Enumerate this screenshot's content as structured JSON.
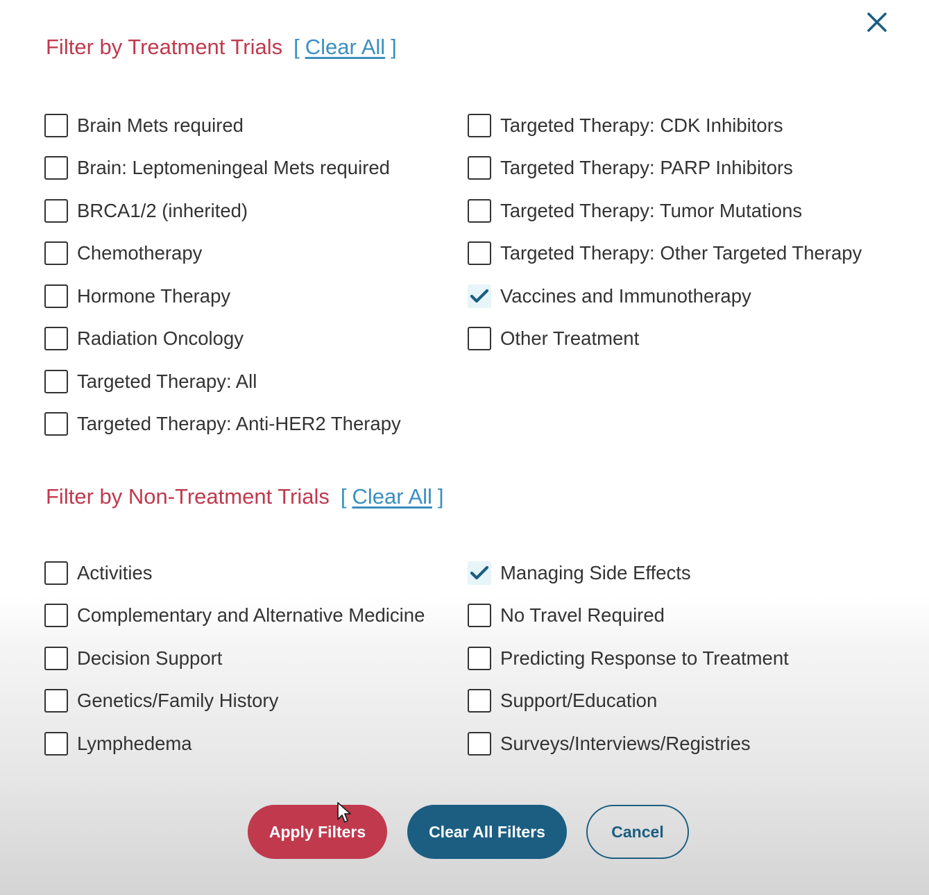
{
  "close_icon": "close-icon",
  "treatment": {
    "title": "Filter by Treatment Trials",
    "bracket_open": "[",
    "clear_label": "Clear All",
    "bracket_close": "]",
    "left_options": [
      {
        "label": "Brain Mets required",
        "checked": false
      },
      {
        "label": "Brain: Leptomeningeal Mets required",
        "checked": false
      },
      {
        "label": "BRCA1/2 (inherited)",
        "checked": false
      },
      {
        "label": "Chemotherapy",
        "checked": false
      },
      {
        "label": "Hormone Therapy",
        "checked": false
      },
      {
        "label": "Radiation Oncology",
        "checked": false
      },
      {
        "label": "Targeted Therapy: All",
        "checked": false
      },
      {
        "label": "Targeted Therapy: Anti-HER2 Therapy",
        "checked": false
      }
    ],
    "right_options": [
      {
        "label": "Targeted Therapy: CDK Inhibitors",
        "checked": false
      },
      {
        "label": "Targeted Therapy: PARP Inhibitors",
        "checked": false
      },
      {
        "label": "Targeted Therapy: Tumor Mutations",
        "checked": false
      },
      {
        "label": "Targeted Therapy: Other Targeted Therapy",
        "checked": false
      },
      {
        "label": "Vaccines and Immunotherapy",
        "checked": true
      },
      {
        "label": "Other Treatment",
        "checked": false
      }
    ]
  },
  "non_treatment": {
    "title": "Filter by Non-Treatment Trials",
    "bracket_open": "[",
    "clear_label": "Clear All",
    "bracket_close": "]",
    "left_options": [
      {
        "label": "Activities",
        "checked": false
      },
      {
        "label": "Complementary and Alternative Medicine",
        "checked": false
      },
      {
        "label": "Decision Support",
        "checked": false
      },
      {
        "label": "Genetics/Family History",
        "checked": false
      },
      {
        "label": "Lymphedema",
        "checked": false
      }
    ],
    "right_options": [
      {
        "label": "Managing Side Effects",
        "checked": true
      },
      {
        "label": "No Travel Required",
        "checked": false
      },
      {
        "label": "Predicting Response to Treatment",
        "checked": false
      },
      {
        "label": "Support/Education",
        "checked": false
      },
      {
        "label": "Surveys/Interviews/Registries",
        "checked": false
      }
    ]
  },
  "footer": {
    "apply_label": "Apply Filters",
    "clear_all_label": "Clear All Filters",
    "cancel_label": "Cancel"
  },
  "colors": {
    "section_title": "#c0394d",
    "link": "#3a8fbf",
    "apply_bg": "#c0394d",
    "clear_bg": "#1b5e82",
    "check": "#1b5e82"
  }
}
